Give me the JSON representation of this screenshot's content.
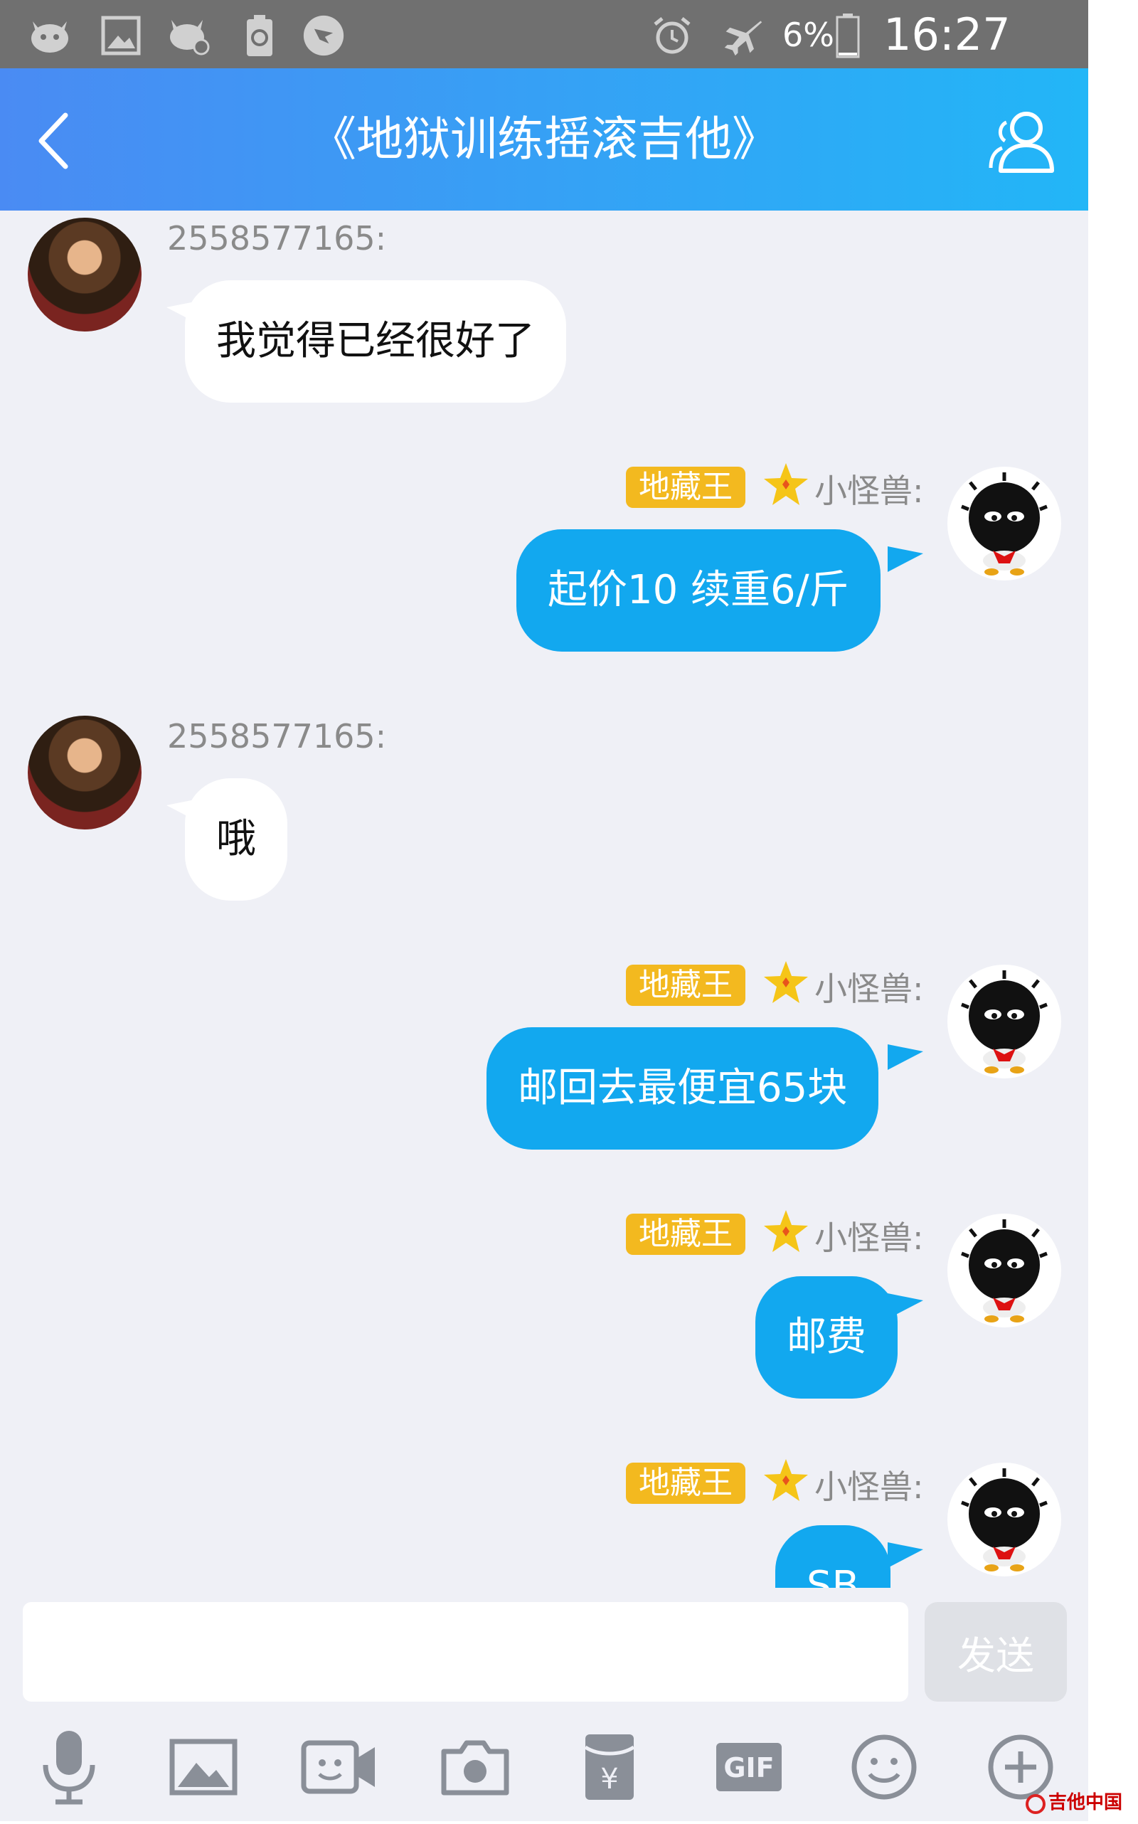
{
  "status_bar": {
    "battery": "6%",
    "time": "16:27",
    "icons": [
      "qq-icon",
      "image-notification-icon",
      "qq-muted-icon",
      "battery-saver-icon",
      "dingtalk-icon",
      "alarm-icon",
      "airplane-mode-icon",
      "battery-icon"
    ]
  },
  "header": {
    "title": "《地狱训练摇滚吉他》",
    "back_icon": "chevron-left-icon",
    "members_icon": "group-members-icon"
  },
  "messages": [
    {
      "direction": "in",
      "sender": "2558577165:",
      "text": "我觉得已经很好了",
      "avatar": "portrait-avatar"
    },
    {
      "direction": "out",
      "badge": "地藏王",
      "sender": "小怪兽:",
      "text": "起价10 续重6/斤",
      "avatar": "black-fluffy-penguin-avatar"
    },
    {
      "direction": "in",
      "sender": "2558577165:",
      "text": "哦",
      "avatar": "portrait-avatar"
    },
    {
      "direction": "out",
      "badge": "地藏王",
      "sender": "小怪兽:",
      "text": "邮回去最便宜65块",
      "avatar": "black-fluffy-penguin-avatar"
    },
    {
      "direction": "out",
      "badge": "地藏王",
      "sender": "小怪兽:",
      "text": "邮费",
      "avatar": "black-fluffy-penguin-avatar"
    },
    {
      "direction": "out",
      "badge": "地藏王",
      "sender": "小怪兽:",
      "text": "SB",
      "avatar": "black-fluffy-penguin-avatar"
    }
  ],
  "input": {
    "value": "",
    "placeholder": "",
    "send_label": "发送"
  },
  "toolbar": {
    "items": [
      "microphone-icon",
      "image-icon",
      "video-call-icon",
      "camera-icon",
      "red-envelope-icon",
      "gif-icon",
      "emoji-icon",
      "plus-icon"
    ],
    "gif_label": "GIF",
    "yuan_symbol": "¥"
  },
  "watermark": {
    "text": "吉他中国"
  },
  "colors": {
    "header_start": "#4a8bf3",
    "header_end": "#22b6f7",
    "outgoing_bubble": "#12a8ef",
    "incoming_bubble": "#ffffff",
    "badge": "#f3b91f",
    "chat_bg": "#eff0f6"
  }
}
